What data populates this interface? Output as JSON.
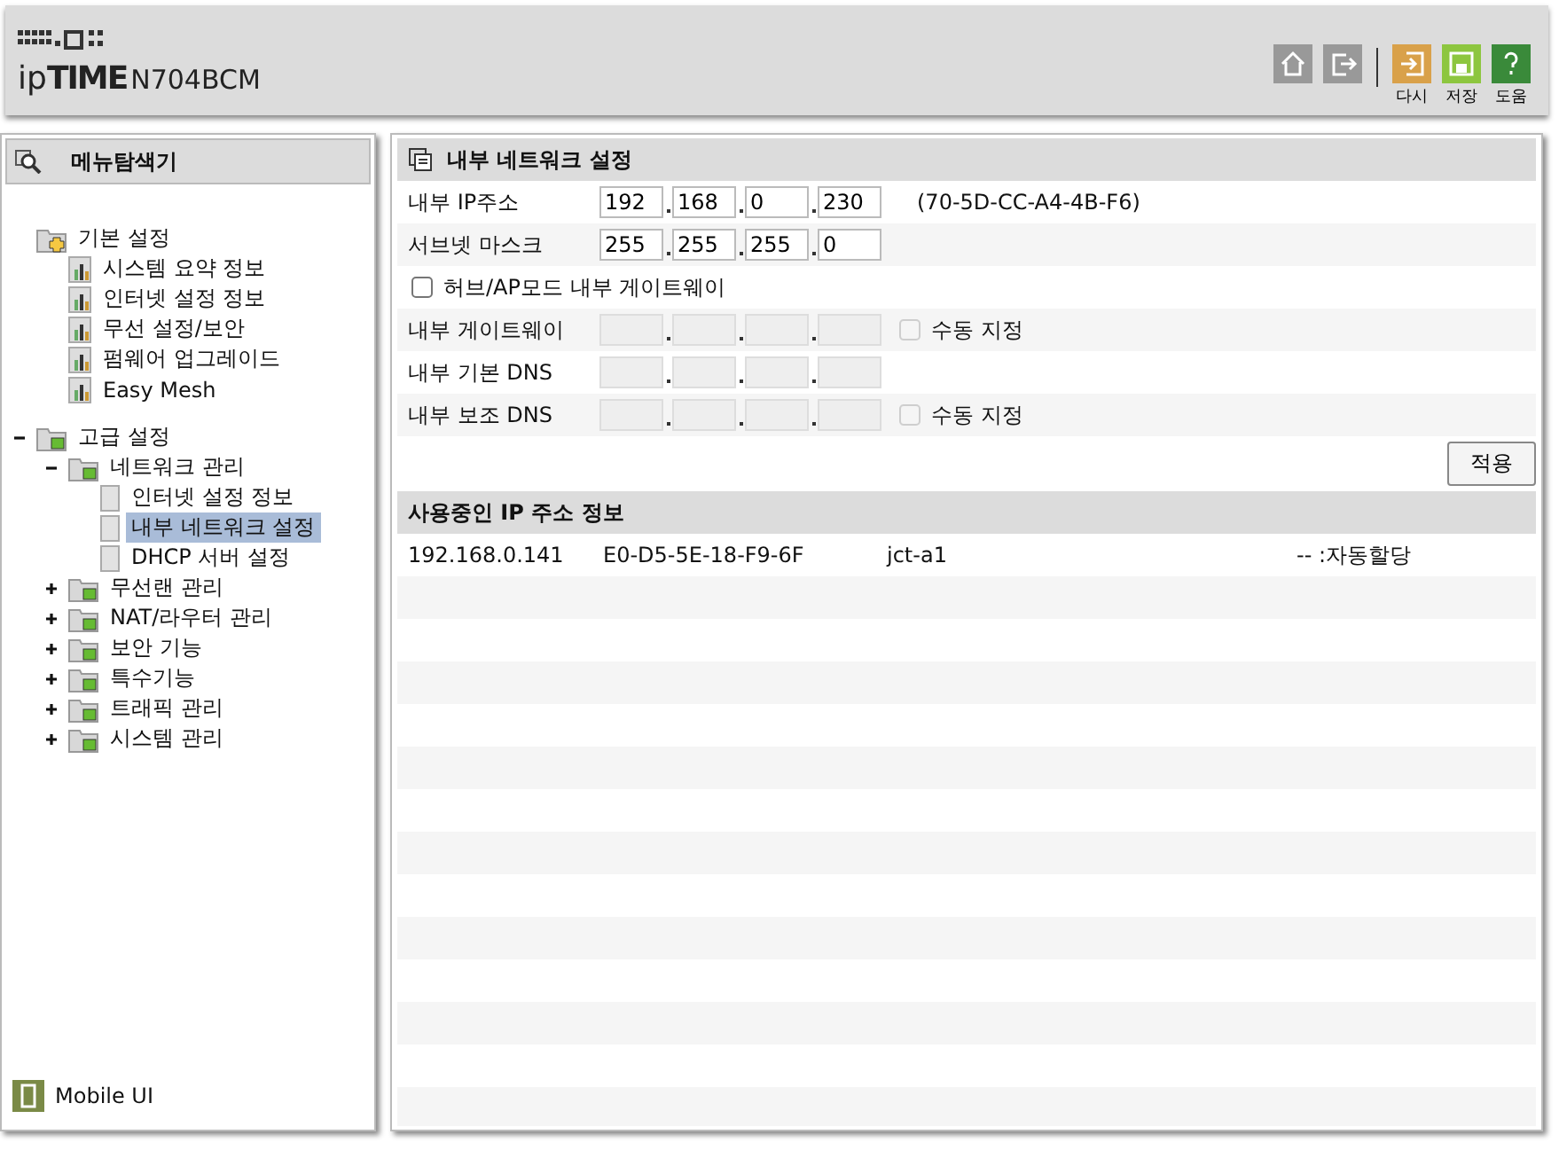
{
  "header": {
    "logo": "ip**TIME**",
    "model": "N704BCM",
    "tools": [
      {
        "kind": "home"
      },
      {
        "kind": "logout"
      },
      {
        "kind": "redo",
        "label": "다시"
      },
      {
        "kind": "save",
        "label": "저장"
      },
      {
        "kind": "help",
        "label": "도움"
      }
    ]
  },
  "sidebar": {
    "title": "메뉴탐색기",
    "basic": {
      "label": "기본 설정",
      "children": [
        {
          "label": "시스템 요약 정보",
          "selected": false
        },
        {
          "label": "인터넷 설정 정보",
          "selected": false
        },
        {
          "label": "무선 설정/보안",
          "selected": false
        },
        {
          "label": "펌웨어 업그레이드",
          "selected": false
        },
        {
          "label": "Easy Mesh",
          "selected": false
        }
      ]
    },
    "advanced": [
      {
        "label": "고급 설정",
        "expanded": true,
        "children": [
          {
            "label": "네트워크 관리",
            "expanded": true,
            "children": [
              {
                "label": "인터넷 설정 정보",
                "selected": false
              },
              {
                "label": "내부 네트워크 설정",
                "selected": true
              },
              {
                "label": "DHCP 서버 설정",
                "selected": false
              }
            ]
          },
          {
            "label": "무선랜 관리",
            "expanded": false
          },
          {
            "label": "NAT/라우터 관리",
            "expanded": false
          },
          {
            "label": "보안 기능",
            "expanded": false
          },
          {
            "label": "특수기능",
            "expanded": false
          },
          {
            "label": "트래픽 관리",
            "expanded": false
          },
          {
            "label": "시스템 관리",
            "expanded": false
          }
        ]
      }
    ],
    "footer": "Mobile UI"
  },
  "panel": {
    "title": "내부 네트워크 설정",
    "rows": [
      {
        "kind": "ip",
        "label": "내부 IP주소",
        "octets": [
          "192",
          "168",
          "0",
          "230"
        ],
        "disabled": false,
        "note": "(70-5D-CC-A4-4B-F6)"
      },
      {
        "kind": "ip",
        "label": "서브넷 마스크",
        "octets": [
          "255",
          "255",
          "255",
          "0"
        ],
        "disabled": false
      },
      {
        "kind": "check",
        "label": "허브/AP모드 내부 게이트웨이",
        "checked": false
      },
      {
        "kind": "ip",
        "label": "내부 게이트웨이",
        "disabled": true,
        "manual": {
          "label": "수동 지정",
          "checked": false
        }
      },
      {
        "kind": "ip",
        "label": "내부 기본 DNS",
        "disabled": true
      },
      {
        "kind": "ip",
        "label": "내부 보조 DNS",
        "disabled": true,
        "manual": {
          "label": "수동 지정",
          "checked": false
        }
      }
    ],
    "apply": "적용"
  },
  "leases": {
    "title": "사용중인 IP 주소 정보",
    "rows": [
      {
        "ip": "192.168.0.141",
        "mac": "E0-D5-5E-18-F9-6F",
        "name": "jct-a1",
        "type": "-- :자동할당"
      }
    ]
  }
}
